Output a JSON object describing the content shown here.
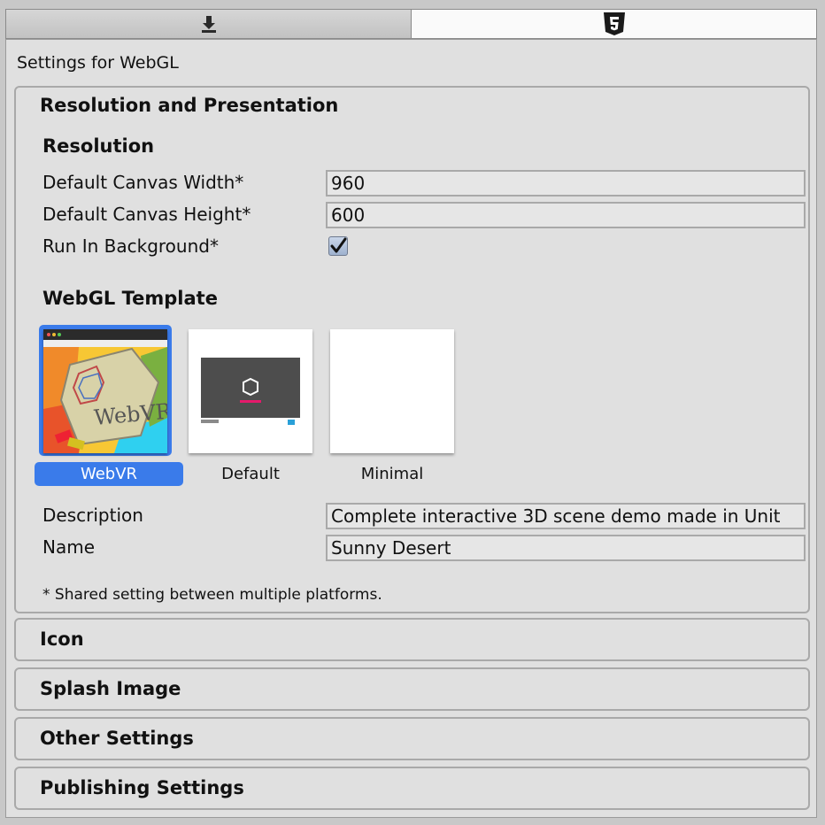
{
  "platform_tabs": [
    {
      "icon": "download-arrow-icon",
      "active": false
    },
    {
      "icon": "html5-icon",
      "active": true
    }
  ],
  "header": {
    "title": "Settings for WebGL"
  },
  "resolution_section": {
    "title": "Resolution and Presentation",
    "resolution_header": "Resolution",
    "fields": {
      "canvas_width_label": "Default Canvas Width*",
      "canvas_width_value": "960",
      "canvas_height_label": "Default Canvas Height*",
      "canvas_height_value": "600",
      "run_in_background_label": "Run In Background*",
      "run_in_background_checked": true
    },
    "template_header": "WebGL Template",
    "templates": [
      {
        "label": "WebVR",
        "selected": true,
        "preview_text": "WebVR"
      },
      {
        "label": "Default",
        "selected": false
      },
      {
        "label": "Minimal",
        "selected": false
      }
    ],
    "description_label": "Description",
    "description_value": "Complete interactive 3D scene demo made in Unit",
    "name_label": "Name",
    "name_value": "Sunny Desert",
    "footnote": "* Shared setting between multiple platforms."
  },
  "collapsed_sections": [
    "Icon",
    "Splash Image",
    "Other Settings",
    "Publishing Settings"
  ],
  "colors": {
    "selection_blue": "#3a7bea",
    "panel_background": "#e0e0e0",
    "field_background": "#e6e6e6",
    "brand_pink": "#e5196b"
  }
}
